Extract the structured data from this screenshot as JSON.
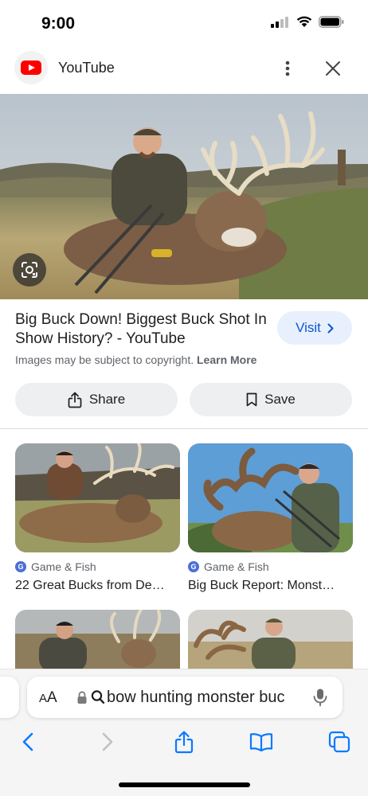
{
  "status_bar": {
    "time": "9:00"
  },
  "header": {
    "title": "YouTube"
  },
  "result": {
    "title": "Big Buck Down! Biggest Buck Shot In Show History? - YouTube",
    "visit_label": "Visit",
    "copyright_text": "Images may be subject to copyright.",
    "learn_more": "Learn More"
  },
  "actions": {
    "share_label": "Share",
    "save_label": "Save"
  },
  "related": [
    {
      "source": "Game & Fish",
      "title": "22 Great Bucks from De…"
    },
    {
      "source": "Game & Fish",
      "title": "Big Buck Report: Monst…"
    }
  ],
  "address_bar": {
    "aa": "AA",
    "query": "bow hunting monster buc"
  },
  "icons": {
    "visit": "chevron-right-icon",
    "share": "share-icon",
    "save": "bookmark-icon",
    "lens": "lens-icon"
  },
  "colors": {
    "accent": "#0b57d0",
    "youtube_red": "#ff0000",
    "safari_blue": "#0a7aff"
  }
}
